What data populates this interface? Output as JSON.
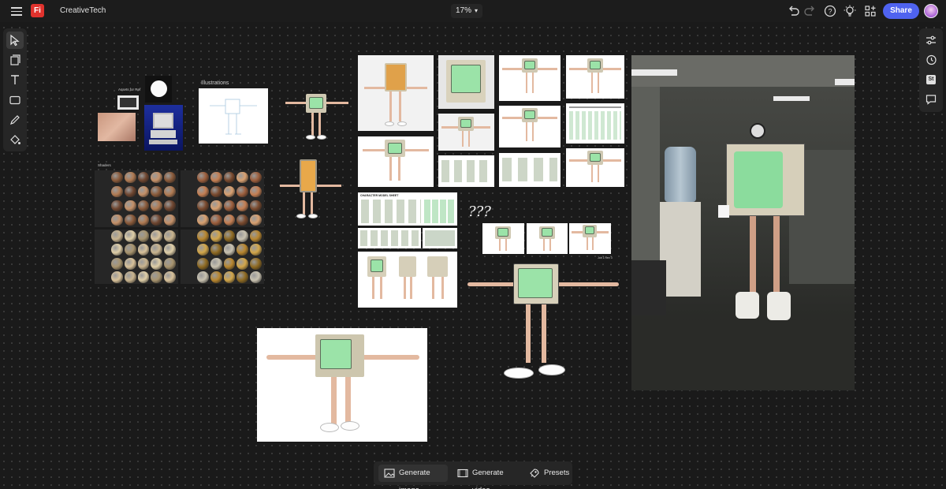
{
  "app": {
    "logo_text": "Fi",
    "doc_title": "CreativeTech",
    "zoom_level": "17%",
    "share_label": "Share"
  },
  "icons": {
    "menu": "hamburger-menu-icon",
    "undo": "undo-icon",
    "redo": "redo-icon",
    "help": "help-icon",
    "tips": "lightbulb-icon",
    "apps": "apps-icon"
  },
  "left_tools": [
    "select-tool",
    "page-tool",
    "text-tool",
    "shape-tool",
    "draw-tool",
    "fill-tool"
  ],
  "right_tools": [
    "adjustments",
    "history",
    "stock",
    "comments"
  ],
  "right_tools_stock_text": "St",
  "canvas": {
    "assets_label": "Assets for Ref",
    "illustrations_label": "Illustrations",
    "shaders_label": "Shaders",
    "question_marks": "???",
    "model_sheet_title": "CHARACTER MODEL SHEET",
    "small_caption": "Job 1 Rev 3"
  },
  "bottom_bar": {
    "generate_image": "Generate image",
    "generate_video": "Generate video",
    "presets": "Presets"
  },
  "colors": {
    "accent": "#4f63f0",
    "logo_red": "#e0322d",
    "canvas_bg": "#1a1a1a",
    "screen_green": "#9be3a8"
  }
}
